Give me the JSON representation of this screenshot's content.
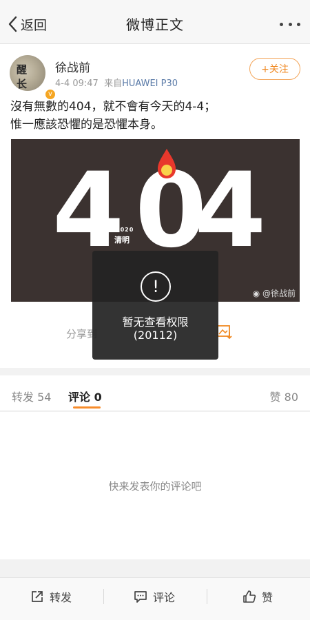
{
  "nav": {
    "back_label": "返回",
    "title": "微博正文",
    "icons": [
      "chevron-left-icon",
      "more-dots-icon"
    ]
  },
  "post": {
    "author": "徐战前",
    "avatar_text": "醒 长",
    "date": "4-4 09:47",
    "source_prefix": "来自",
    "device": "HUAWEI P30",
    "follow_label": "+关注",
    "text_line1": "沒有無數的404，就不會有今天的4-4；",
    "text_line2": "惟一應該恐懼的是恐懼本身。",
    "image": {
      "digits": [
        "4",
        "0",
        "4"
      ],
      "year": "2020",
      "festival": "清明",
      "watermark": "@徐战前",
      "colors": {
        "background": "#3b3230",
        "flame_outer": "#e8382c",
        "flame_inner": "#f9d24a"
      }
    },
    "share_label": "分享到"
  },
  "toast": {
    "message": "暂无查看权限",
    "code": "(20112)",
    "icon": "exclamation-circle-icon"
  },
  "tabs": {
    "repost_label": "转发",
    "repost_count": "54",
    "comment_label": "评论",
    "comment_count": "0",
    "like_label": "赞",
    "like_count": "80"
  },
  "comments": {
    "empty_text": "快来发表你的评论吧"
  },
  "bottom_bar": {
    "repost": "转发",
    "comment": "评论",
    "like": "赞"
  },
  "colors": {
    "accent": "#f78c2b",
    "link": "#5b7ba8"
  }
}
